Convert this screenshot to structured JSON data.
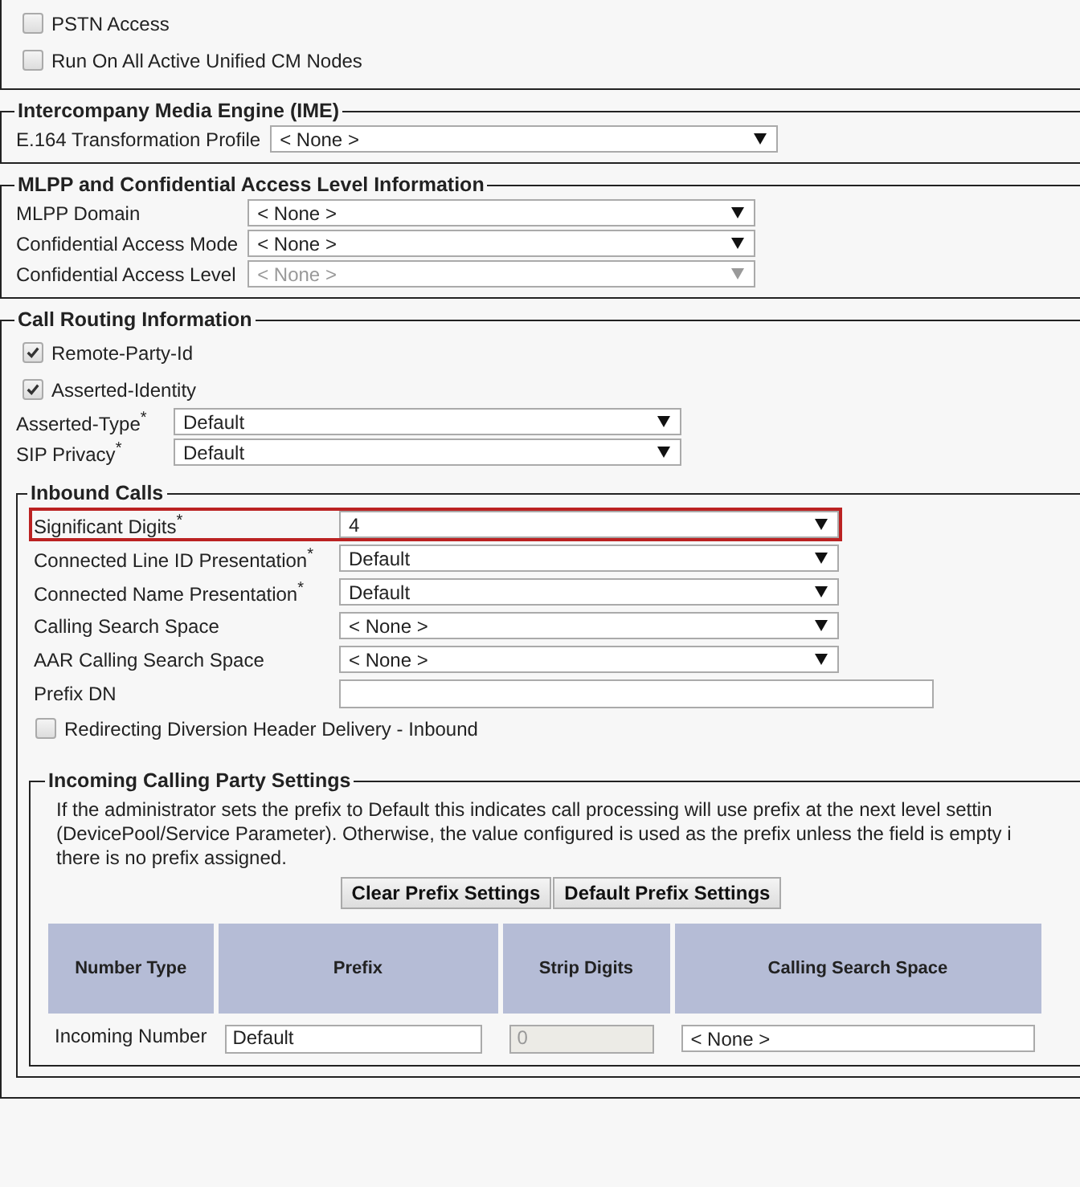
{
  "top_checkboxes": [
    {
      "label": "PSTN Access",
      "checked": false
    },
    {
      "label": "Run On All Active Unified CM Nodes",
      "checked": false
    }
  ],
  "sections": [
    {
      "title": "Intercompany Media Engine (IME)",
      "fields": [
        {
          "label": "E.164 Transformation Profile",
          "value": "< None >",
          "disabled": false
        }
      ]
    },
    {
      "title": "MLPP and Confidential Access Level Information",
      "fields": [
        {
          "label": "MLPP Domain",
          "value": "< None >",
          "disabled": false
        },
        {
          "label": "Confidential Access Mode",
          "value": "< None >",
          "disabled": false
        },
        {
          "label": "Confidential Access Level",
          "value": "< None >",
          "disabled": true
        }
      ]
    }
  ],
  "call_routing": {
    "title": "Call Routing Information",
    "checkboxes": [
      {
        "label": "Remote-Party-Id",
        "checked": true
      },
      {
        "label": "Asserted-Identity",
        "checked": true
      }
    ],
    "fields": [
      {
        "label": "Asserted-Type$^{*}$",
        "value": "Default"
      },
      {
        "label": "SIP Privacy$^{*}$",
        "value": "Default"
      }
    ],
    "inbound": {
      "title": "Inbound Calls",
      "fields": [
        {
          "kind": "select",
          "label": "Significant Digits$^{*}$",
          "value": "4",
          "highlighted": true
        },
        {
          "kind": "select",
          "label": "Connected Line ID Presentation$^{*}$",
          "value": "Default",
          "highlighted": false
        },
        {
          "kind": "select",
          "label": "Connected Name Presentation$^{*}$",
          "value": "Default",
          "highlighted": false
        },
        {
          "kind": "select",
          "label": "Calling Search Space",
          "value": "< None >",
          "highlighted": false
        },
        {
          "kind": "select",
          "label": "AAR Calling Search Space",
          "value": "< None >",
          "highlighted": false
        },
        {
          "kind": "text",
          "label": "Prefix DN",
          "highlighted": false
        }
      ],
      "checkbox": {
        "label": "Redirecting Diversion Header Delivery - Inbound",
        "checked": false
      },
      "incoming": {
        "title": "Incoming Calling Party Settings",
        "note": "If the administrator sets the prefix to Default this indicates call processing will use prefix at the next level settin (DevicePool/Service Parameter). Otherwise, the value configured is used as the prefix unless the field is empty i there is no prefix assigned.",
        "buttons": [
          "Clear Prefix Settings",
          "Default Prefix Settings"
        ],
        "table": {
          "columns": [
            "Number Type",
            "Prefix",
            "Strip Digits",
            "Calling Search Space"
          ],
          "rows": [
            {
              "cells": [
                {
                  "kind": "label",
                  "text": "Incoming Number"
                },
                {
                  "kind": "text",
                  "value": "Default"
                },
                {
                  "kind": "text",
                  "value": "0",
                  "disabled": true
                },
                {
                  "kind": "select",
                  "value": "< None >"
                }
              ]
            }
          ]
        }
      }
    }
  }
}
